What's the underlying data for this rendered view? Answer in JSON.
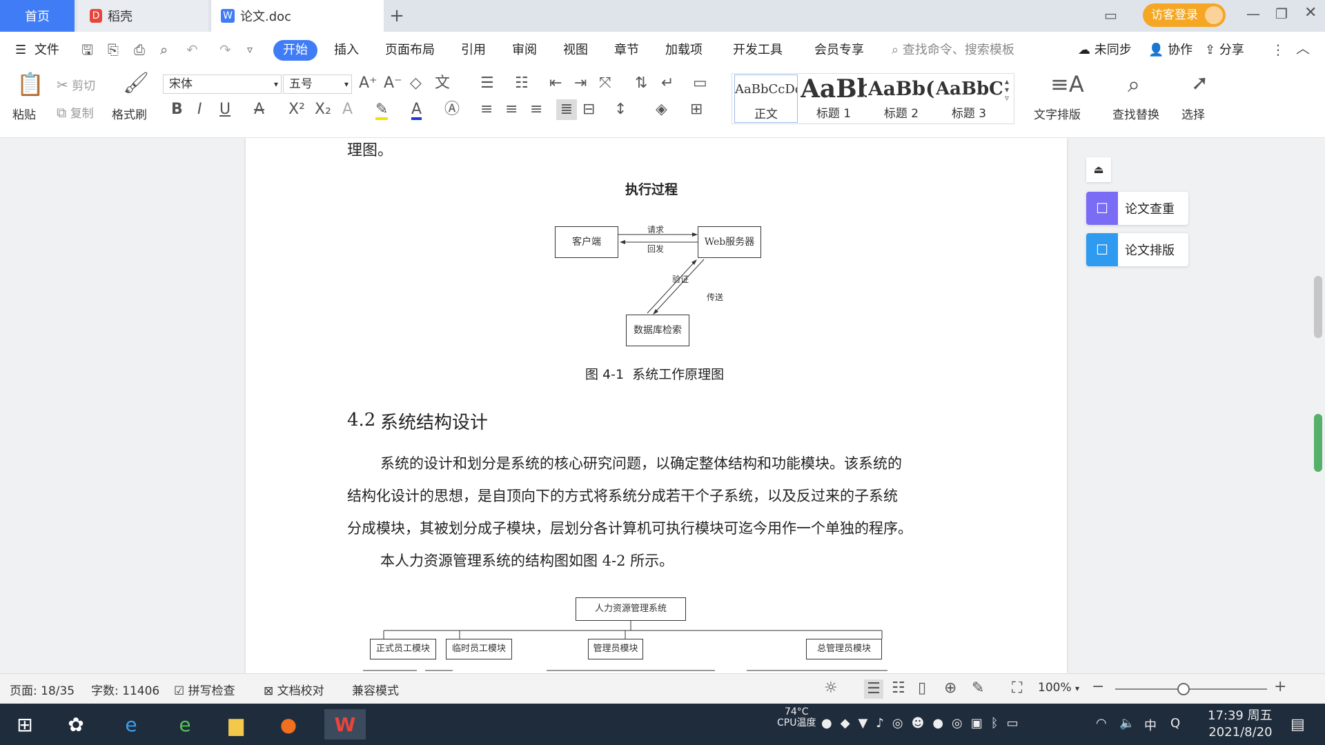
{
  "tabs": {
    "home": "首页",
    "daoke": "稻壳",
    "doc": "论文.doc",
    "add": "+"
  },
  "titlebar": {
    "visitor_login": "访客登录"
  },
  "menu": {
    "file": "文件",
    "items": [
      "开始",
      "插入",
      "页面布局",
      "引用",
      "审阅",
      "视图",
      "章节",
      "加载项",
      "开发工具",
      "会员专享"
    ],
    "search_placeholder": "查找命令、搜索模板",
    "unsync": "未同步",
    "collab": "协作",
    "share": "分享"
  },
  "ribbon": {
    "paste": "粘贴",
    "cut": "剪切",
    "copy": "复制",
    "format_painter": "格式刷",
    "font_name": "宋体",
    "font_size": "五号",
    "styles": [
      {
        "preview": "AaBbCcDd",
        "name": "正文"
      },
      {
        "preview": "AaBb",
        "name": "标题 1"
      },
      {
        "preview": "AaBb(",
        "name": "标题 2"
      },
      {
        "preview": "AaBbC",
        "name": "标题 3"
      }
    ],
    "text_layout": "文字排版",
    "find_replace": "查找替换",
    "select": "选择"
  },
  "document": {
    "line_top": "理图。",
    "diagram1": {
      "title": "执行过程",
      "client": "客户端",
      "web_server": "Web服务器",
      "database": "数据库检索",
      "request": "请求",
      "response": "回发",
      "verify": "验证",
      "send": "传送"
    },
    "figure_caption": "图 4-1  系统工作原理图",
    "section_number": "4.2",
    "section_title": "系统结构设计",
    "para1_line1": "系统的设计和划分是系统的核心研究问题，以确定整体结构和功能模块。该系统的",
    "para1_line2": "结构化设计的思想，是自顶向下的方式将系统分成若干个子系统，以及反过来的子系统",
    "para1_line3": "分成模块，其被划分成子模块，层划分各计算机可执行模块可迄今用作一个单独的程序。",
    "para2": "本人力资源管理系统的结构图如图 4-2 所示。",
    "diagram2": {
      "root": "人力资源管理系统",
      "modules": [
        "正式员工模块",
        "临时员工模块",
        "管理员模块",
        "总管理员模块"
      ]
    }
  },
  "side_panel": {
    "check": "论文查重",
    "layout": "论文排版"
  },
  "status": {
    "page": "页面: 18/35",
    "words": "字数: 11406",
    "spell": "拼写检查",
    "proof": "文档校对",
    "compat": "兼容模式",
    "zoom": "100%"
  },
  "taskbar": {
    "cpu_temp": "74°C",
    "cpu_label": "CPU温度",
    "ime": "中",
    "time": "17:39 周五",
    "date": "2021/8/20"
  },
  "colors": {
    "accent": "#3f7cf5",
    "visitor": "#f5a623",
    "panel_check": "#7b6cf6",
    "panel_layout": "#2f9bf0"
  }
}
